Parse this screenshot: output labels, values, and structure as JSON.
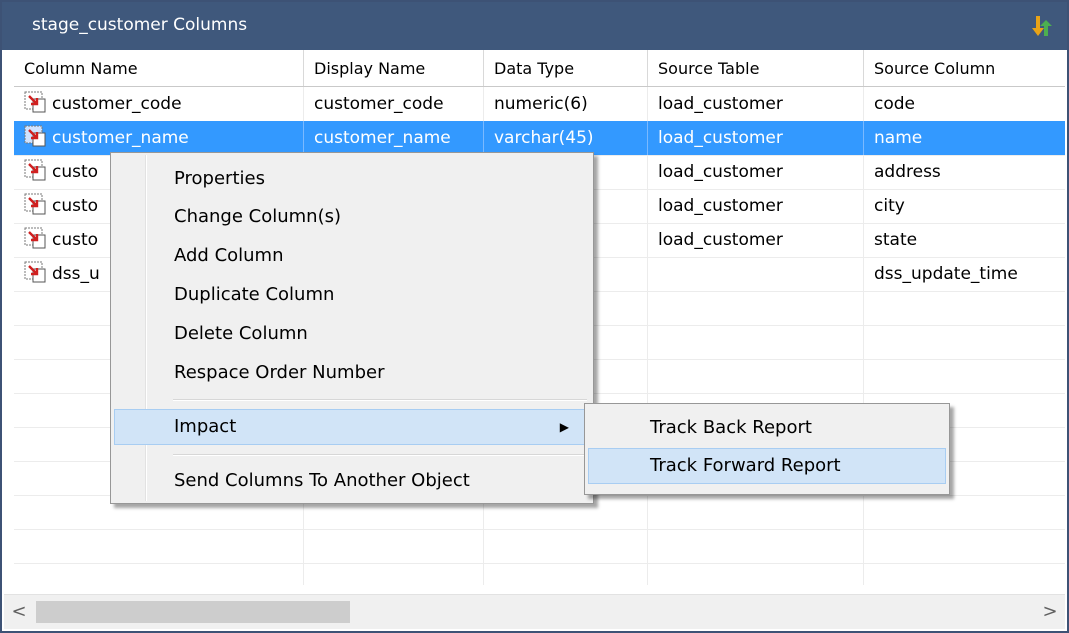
{
  "window": {
    "title": "stage_customer Columns",
    "title_icon": "arrows-icon"
  },
  "columns": [
    "Column Name",
    "Display Name",
    "Data Type",
    "Source Table",
    "Source Column"
  ],
  "rows": [
    {
      "name": "customer_code",
      "display": "customer_code",
      "type": "numeric(6)",
      "source_table": "load_customer",
      "source_column": "code"
    },
    {
      "name": "customer_name",
      "display": "customer_name",
      "type": "varchar(45)",
      "source_table": "load_customer",
      "source_column": "name"
    },
    {
      "name": "custo",
      "display": "",
      "type": ")",
      "source_table": "load_customer",
      "source_column": "address"
    },
    {
      "name": "custo",
      "display": "",
      "type": ")",
      "source_table": "load_customer",
      "source_column": "city"
    },
    {
      "name": "custo",
      "display": "",
      "type": "",
      "source_table": "load_customer",
      "source_column": "state"
    },
    {
      "name": "dss_u",
      "display": "",
      "type": "",
      "source_table": "",
      "source_column": "dss_update_time"
    }
  ],
  "selected_row": 1,
  "context_menu": {
    "items": [
      {
        "label": "Properties"
      },
      {
        "label": "Change Column(s)"
      },
      {
        "label": "Add Column"
      },
      {
        "label": "Duplicate Column"
      },
      {
        "label": "Delete Column"
      },
      {
        "label": "Respace Order Number"
      },
      {
        "label": "Impact"
      },
      {
        "label": "Send Columns To Another Object"
      }
    ]
  },
  "submenu": {
    "items": [
      {
        "label": "Track Back Report"
      },
      {
        "label": "Track Forward Report"
      }
    ]
  },
  "scroll": {
    "left_arrow": "<",
    "right_arrow": ">"
  },
  "colors": {
    "titlebar": "#3f587c",
    "selection": "#3399ff",
    "menu_hover": "#d1e4f7"
  }
}
